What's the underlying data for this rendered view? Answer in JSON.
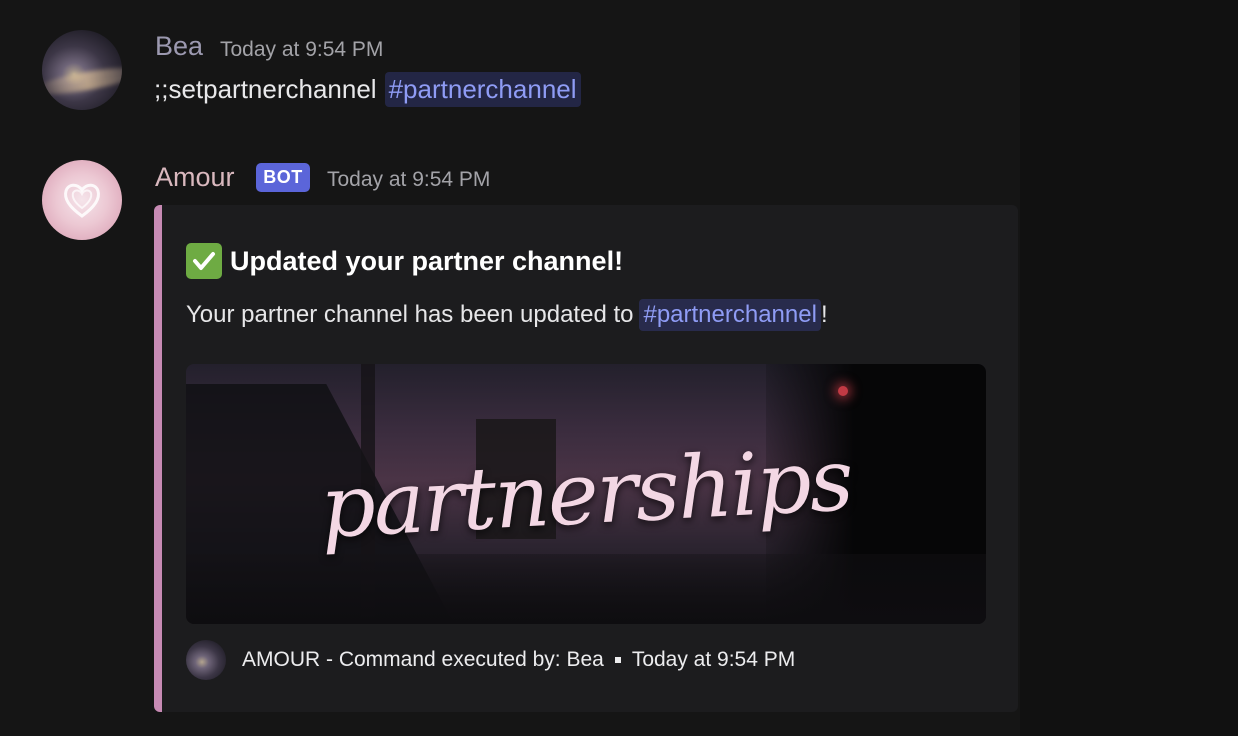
{
  "messages": {
    "bea": {
      "username": "Bea",
      "timestamp": "Today at 9:54 PM",
      "text": ";;setpartnerchannel",
      "mention": "#partnerchannel"
    },
    "amour": {
      "username": "Amour",
      "badge": "BOT",
      "timestamp": "Today at 9:54 PM",
      "embed": {
        "accent_color": "#c78ab4",
        "title_icon": "check-mark-icon",
        "title": "Updated your partner channel!",
        "description_prefix": "Your partner channel has been updated to",
        "description_mention": "#partnerchannel",
        "description_suffix": "!",
        "image_text": "partnerships",
        "footer": {
          "text": "AMOUR - Command executed by: Bea",
          "timestamp": "Today at 9:54 PM"
        }
      }
    }
  },
  "colors": {
    "mention_text": "#8f9cf5",
    "bot_badge": "#5b65d9",
    "check_green": "#6eab43"
  }
}
